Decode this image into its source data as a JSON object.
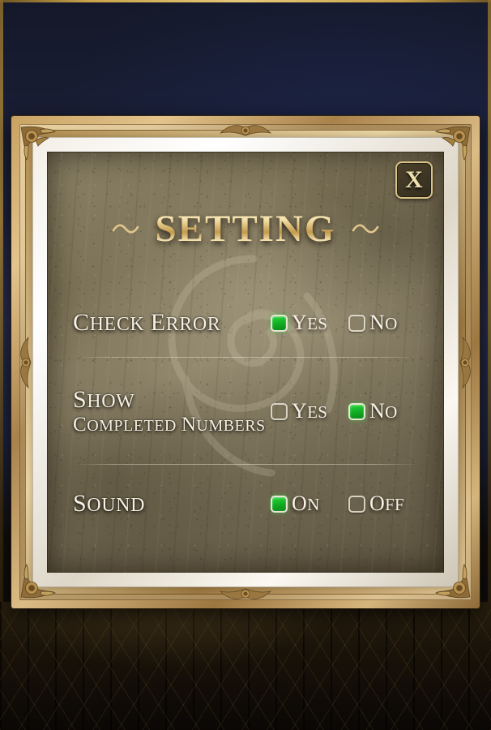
{
  "window": {
    "title": "SETTING",
    "close_label": "X"
  },
  "settings": {
    "rows": [
      {
        "label_line_1": "Check Error",
        "label_line_2": "",
        "options": [
          {
            "label": "Yes",
            "selected": true
          },
          {
            "label": "No",
            "selected": false
          }
        ]
      },
      {
        "label_line_1": "Show",
        "label_line_2": "Completed Numbers",
        "options": [
          {
            "label": "Yes",
            "selected": false
          },
          {
            "label": "No",
            "selected": true
          }
        ]
      },
      {
        "label_line_1": "Sound",
        "label_line_2": "",
        "options": [
          {
            "label": "On",
            "selected": true
          },
          {
            "label": "Off",
            "selected": false
          }
        ]
      }
    ]
  },
  "colors": {
    "checkbox_on": "#11ad22",
    "title_gold": "#f3dfa7",
    "frame_gold": "#c8a262",
    "panel_stone": "#8a8166",
    "label_text": "#f4f0e4"
  }
}
